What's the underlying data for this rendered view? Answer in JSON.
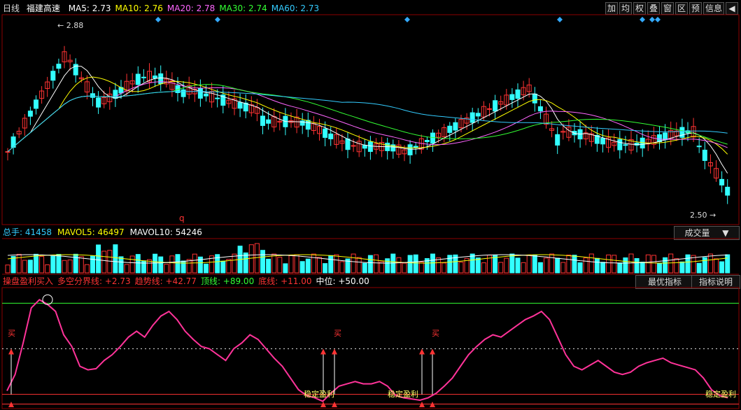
{
  "header": {
    "period": "日线",
    "stock": "福建高速",
    "ma": [
      {
        "label": "MA5: 2.73",
        "color": "#ffffff"
      },
      {
        "label": "MA10: 2.76",
        "color": "#ffff00"
      },
      {
        "label": "MA20: 2.78",
        "color": "#ff66ff"
      },
      {
        "label": "MA30: 2.74",
        "color": "#33ff33"
      },
      {
        "label": "MA60: 2.73",
        "color": "#33ccff"
      }
    ],
    "toolbar": [
      "加",
      "均",
      "权",
      "叠",
      "窗",
      "区",
      "预",
      "信息",
      "◀"
    ]
  },
  "price_panel": {
    "high_label": "2.88",
    "low_label": "2.50",
    "marker": "q"
  },
  "volume_header": {
    "items": [
      {
        "label": "总手: 41458",
        "color": "#33ccff"
      },
      {
        "label": "MAVOL5: 46497",
        "color": "#ffff00"
      },
      {
        "label": "MAVOL10: 54246",
        "color": "#ffffff"
      }
    ],
    "dropdown": "成交量"
  },
  "indicator_header": {
    "items": [
      {
        "label": "操盘盈利买入",
        "color": "#ff3333"
      },
      {
        "label": "多空分界线: +2.73",
        "color": "#ff3333"
      },
      {
        "label": "趋势线: +42.77",
        "color": "#ff3333"
      },
      {
        "label": "顶线: +89.00",
        "color": "#33ff33"
      },
      {
        "label": "底线: +11.00",
        "color": "#ff3333"
      },
      {
        "label": "中位: +50.00",
        "color": "#ffffff"
      }
    ],
    "buttons": [
      "最优指标",
      "指标说明"
    ],
    "buy_label": "买",
    "profit_label": "稳定盈利"
  },
  "chart_data": [
    {
      "type": "candlestick",
      "high": 2.88,
      "low": 2.5,
      "series": [
        {
          "name": "MA5",
          "values": [
            2.73
          ]
        },
        {
          "name": "MA10",
          "values": [
            2.76
          ]
        },
        {
          "name": "MA20",
          "values": [
            2.78
          ]
        },
        {
          "name": "MA30",
          "values": [
            2.74
          ]
        },
        {
          "name": "MA60",
          "values": [
            2.73
          ]
        }
      ]
    },
    {
      "type": "bar",
      "series": [
        {
          "name": "总手",
          "values": [
            41458
          ]
        },
        {
          "name": "MAVOL5",
          "values": [
            46497
          ]
        },
        {
          "name": "MAVOL10",
          "values": [
            54246
          ]
        }
      ]
    },
    {
      "type": "line",
      "ylim": [
        11,
        89
      ],
      "series": [
        {
          "name": "趋势线",
          "values": [
            14,
            28,
            55,
            85,
            92,
            88,
            82,
            62,
            52,
            35,
            32,
            33,
            40,
            45,
            52,
            60,
            65,
            60,
            70,
            78,
            82,
            75,
            65,
            58,
            52,
            50,
            45,
            40,
            50,
            55,
            62,
            58,
            50,
            42,
            35,
            25,
            15,
            10,
            8,
            5,
            12,
            18,
            20,
            22,
            20,
            20,
            22,
            18,
            10,
            8,
            7,
            6,
            8,
            12,
            18,
            25,
            35,
            45,
            52,
            58,
            62,
            60,
            65,
            70,
            75,
            78,
            82,
            75,
            60,
            45,
            35,
            32,
            36,
            40,
            35,
            30,
            28,
            30,
            35,
            38,
            40,
            42,
            38,
            36,
            34,
            32,
            25,
            15,
            10,
            8
          ]
        }
      ],
      "levels": {
        "top": 89,
        "mid": 50,
        "bottom": 11,
        "divider": 2.73
      }
    }
  ]
}
